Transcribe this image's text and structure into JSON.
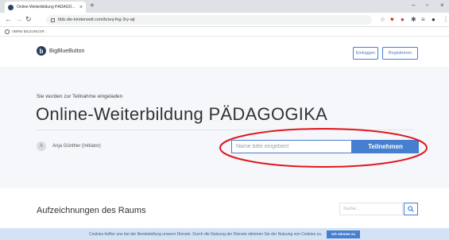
{
  "browser": {
    "tab_title": "Online-Weiterbildung PÄDAGO...",
    "tab_close": "×",
    "new_tab": "+",
    "url": "bbb.die-kinderwelt.com/b/anj-fng-3ry-ajt",
    "bookmark_label": "VBRW BILDUNGSP...",
    "window_controls": [
      "–",
      "▫",
      "×"
    ]
  },
  "header": {
    "logo_text": "BigBlueButton",
    "login_label": "Einloggen",
    "register_label": "Registrieren"
  },
  "room": {
    "invited_text": "Sie wurden zur Teilnahme eingeladen",
    "title": "Online-Weiterbildung PÄDAGOGIKA",
    "owner_initial": "A",
    "owner_name": "Anja Günther (Initiator)",
    "name_placeholder": "Name bitte eingeben!",
    "join_label": "Teilnehmen"
  },
  "recordings": {
    "title": "Aufzeichnungen des Raums",
    "search_placeholder": "Suche..."
  },
  "cookie": {
    "text": "Cookies helfen uns bei der Bereitstellung unserer Dienste. Durch die Nutzung der Dienste stimmen Sie der Nutzung von Cookies zu.",
    "accept_label": "Ich stimme zu"
  },
  "colors": {
    "accent": "#467fcf",
    "annotation": "#e0191e",
    "hero_bg": "#f5f7fb",
    "cookie_bg": "#d3e3f5"
  }
}
